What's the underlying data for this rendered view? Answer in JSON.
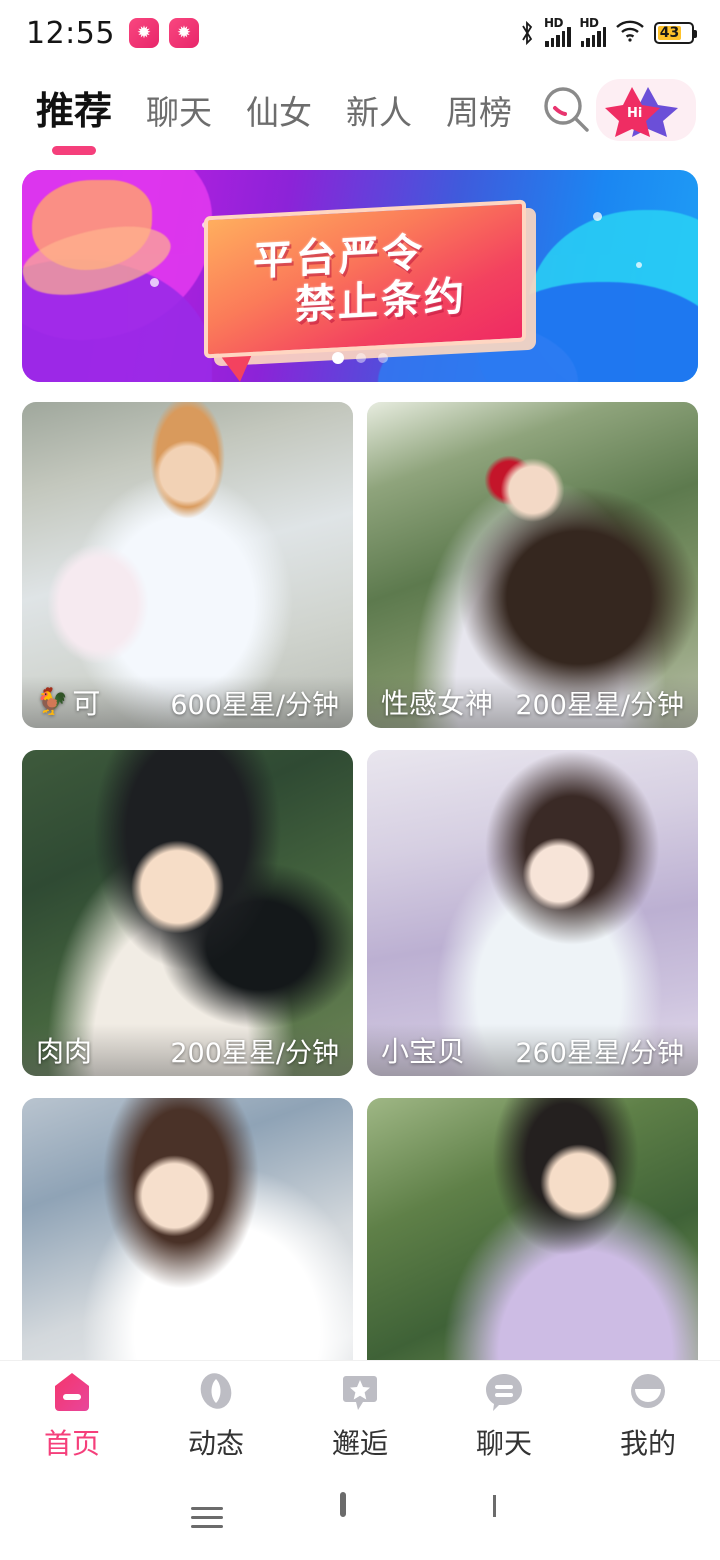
{
  "status_bar": {
    "time": "12:55",
    "app_badges": [
      "star-badge",
      "star-badge"
    ],
    "bluetooth": "bluetooth-icon",
    "signal_1_label": "HD",
    "signal_2_label": "HD",
    "wifi": "wifi-icon",
    "battery_percent": "43"
  },
  "top_nav": {
    "tabs": [
      {
        "label": "推荐",
        "active": true
      },
      {
        "label": "聊天",
        "active": false
      },
      {
        "label": "仙女",
        "active": false
      },
      {
        "label": "新人",
        "active": false
      },
      {
        "label": "周榜",
        "active": false
      }
    ],
    "search_icon": "search-icon",
    "logo_text": "Hi",
    "accent_color": "#f53f7b"
  },
  "banner": {
    "title_line1": "平台严令",
    "title_line2": "禁止条约",
    "dots_total": 3,
    "active_dot": 1
  },
  "cards": [
    {
      "name": "可",
      "emoji": "🐓",
      "price": "600星星/分钟"
    },
    {
      "name": "性感女神",
      "emoji": "",
      "price": "200星星/分钟"
    },
    {
      "name": "肉肉",
      "emoji": "",
      "price": "200星星/分钟"
    },
    {
      "name": "小宝贝",
      "emoji": "",
      "price": "260星星/分钟"
    },
    {
      "name": "",
      "emoji": "",
      "price": ""
    },
    {
      "name": "",
      "emoji": "",
      "price": ""
    }
  ],
  "bottom_nav": [
    {
      "label": "首页",
      "icon": "home-icon",
      "active": true
    },
    {
      "label": "动态",
      "icon": "leaf-icon",
      "active": false
    },
    {
      "label": "邂逅",
      "icon": "star-bubble-icon",
      "active": false
    },
    {
      "label": "聊天",
      "icon": "chat-bubble-icon",
      "active": false
    },
    {
      "label": "我的",
      "icon": "profile-icon",
      "active": false
    }
  ],
  "system_nav": {
    "recents": "menu-icon",
    "home": "home-square-icon",
    "back": "back-chevron-icon"
  }
}
